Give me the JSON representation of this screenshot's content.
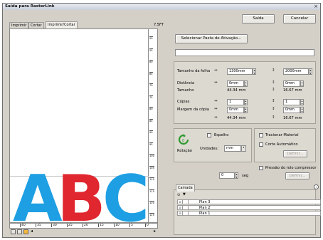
{
  "window": {
    "title": "Saída para RasterLink",
    "close_glyph": "×"
  },
  "buttons": {
    "saida": "Saída",
    "cancelar": "Cancelar",
    "select_folder": "Selecionar Pasta de Ativação..."
  },
  "tabs": [
    "Imprimir",
    "Cortar",
    "Imprimir/Cortar"
  ],
  "size_label": "7.5FT",
  "preview": {
    "letters": [
      {
        "char": "A",
        "color": "#1e9fe3"
      },
      {
        "char": "B",
        "color": "#e0262f"
      },
      {
        "char": "C",
        "color": "#1e9fe3"
      }
    ],
    "hruler_ticks": [
      "40",
      "35",
      "30",
      "25",
      "20",
      "15",
      "10",
      "5",
      "0"
    ],
    "vruler_ticks": [
      "50",
      "55",
      "60",
      "65",
      "70",
      "75",
      "80",
      "85",
      "90",
      "95",
      "100",
      "105",
      "110",
      "115",
      "120",
      "125"
    ]
  },
  "settings": {
    "tamanho_folha": {
      "label": "Tamanho da folha",
      "width": "1300mm",
      "height": "2000mm"
    },
    "distancia": {
      "label": "Distância",
      "x": "0mm",
      "y": "0mm"
    },
    "tamanho": {
      "label": "Tamanho",
      "x": "44.34 mm",
      "y": "16.67 mm"
    },
    "copias": {
      "label": "Cópias",
      "x": "1",
      "y": "1"
    },
    "margem": {
      "label": "Margem da cópia",
      "x": "0mm",
      "y": "0mm"
    },
    "total": {
      "x": "44.34 mm",
      "y": "16.67 mm"
    }
  },
  "rotation": {
    "value": "0",
    "label": "Rotação",
    "espelho": "Espelho",
    "unidades_label": "Unidades:",
    "unidades_value": "mm",
    "angle": "0",
    "angle_unit": "seg"
  },
  "options": {
    "tracionar": "Tracionar Material",
    "corte_auto": "Corte Automático",
    "definir": "Definir...",
    "pressao": "Pressão do rolo compressor",
    "pressao_btn": "Definir..."
  },
  "layers": {
    "tab": "Camada",
    "items": [
      "Plan 3",
      "Plan 2",
      "Plan 1"
    ]
  }
}
